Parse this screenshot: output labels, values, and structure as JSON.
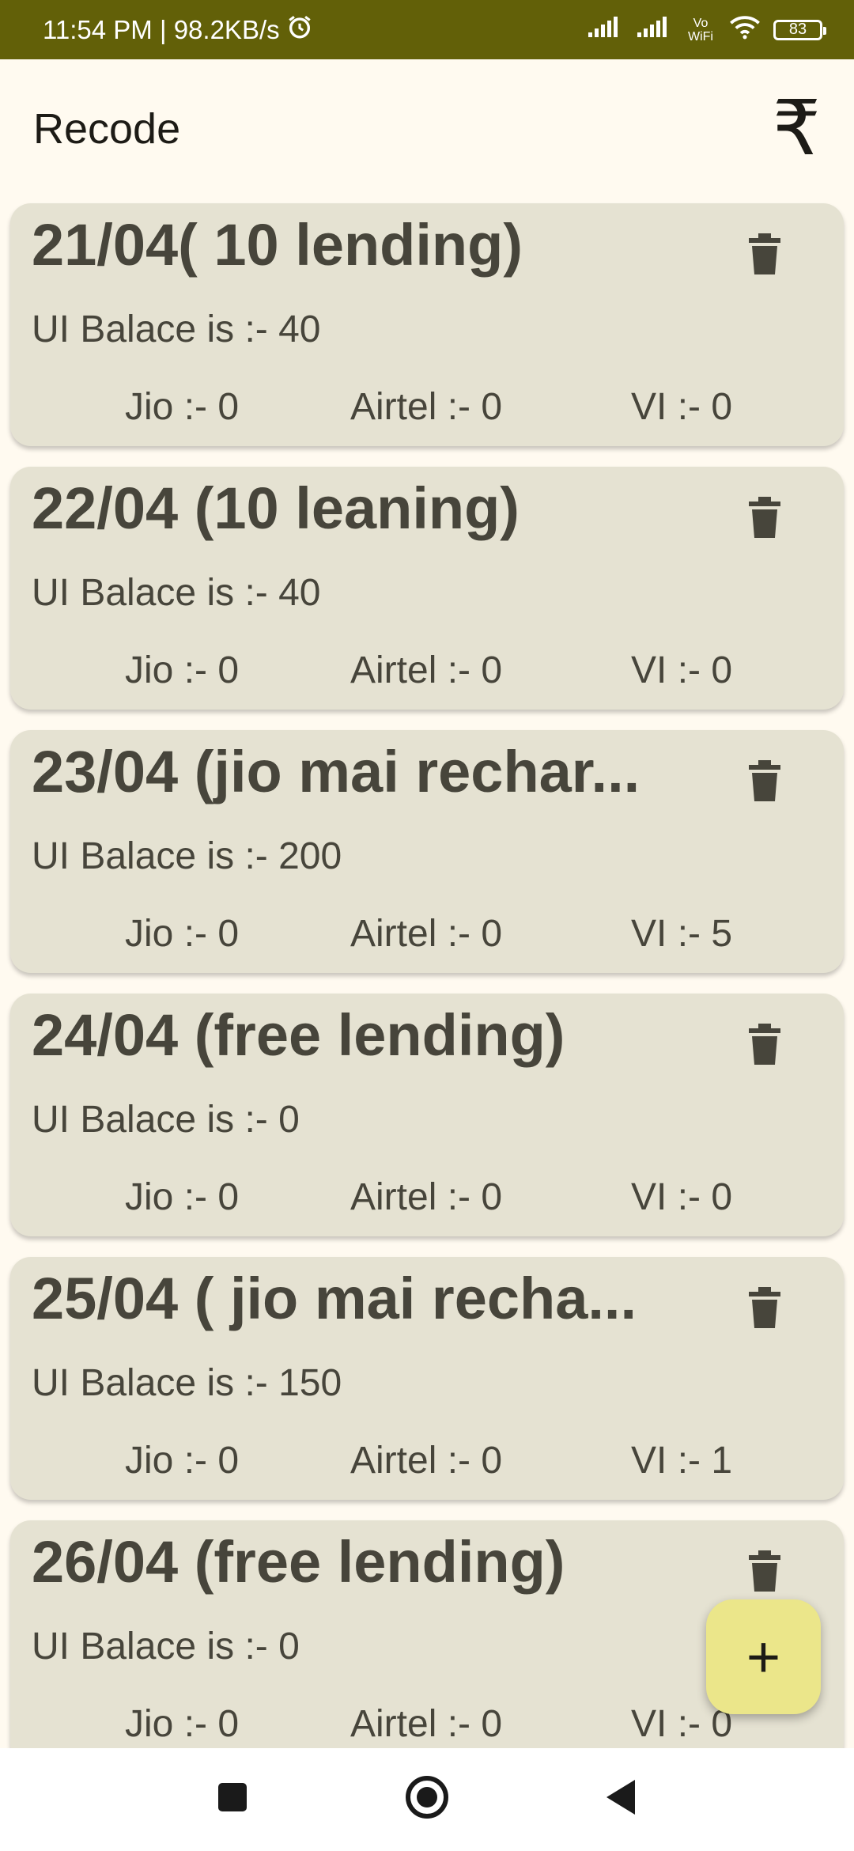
{
  "status_bar": {
    "time_speed": "11:54 PM | 98.2KB/s",
    "alarm_icon": "alarm-icon",
    "volte_label": "Vo WiFi",
    "battery": "83"
  },
  "app_bar": {
    "title": "Recode",
    "action_icon": "₹"
  },
  "cards": [
    {
      "title": "21/04( 10 lending)",
      "balance": "UI Balace is :- 40",
      "jio": "Jio :- 0",
      "airtel": "Airtel :- 0",
      "vi": "VI :- 0"
    },
    {
      "title": "22/04 (10 leaning)",
      "balance": "UI Balace is :- 40",
      "jio": "Jio :- 0",
      "airtel": "Airtel :- 0",
      "vi": "VI :- 0"
    },
    {
      "title": "23/04 (jio mai rechar...",
      "balance": "UI Balace is :- 200",
      "jio": "Jio :- 0",
      "airtel": "Airtel :- 0",
      "vi": "VI :- 5"
    },
    {
      "title": "24/04 (free lending)",
      "balance": "UI Balace is :- 0",
      "jio": "Jio :- 0",
      "airtel": "Airtel :- 0",
      "vi": "VI :- 0"
    },
    {
      "title": "25/04 ( jio mai recha...",
      "balance": "UI Balace is :- 150",
      "jio": "Jio :- 0",
      "airtel": "Airtel :- 0",
      "vi": "VI :- 1"
    },
    {
      "title": "26/04 (free lending)",
      "balance": "UI Balace is :- 0",
      "jio": "Jio :- 0",
      "airtel": "Airtel :- 0",
      "vi": "VI :- 0"
    }
  ],
  "fab": {
    "label": "+"
  },
  "colors": {
    "status_bar": "#626008",
    "background": "#fffaf0",
    "card": "#e5e2d2",
    "card_text": "#47453b",
    "fab": "#ebe68a"
  }
}
